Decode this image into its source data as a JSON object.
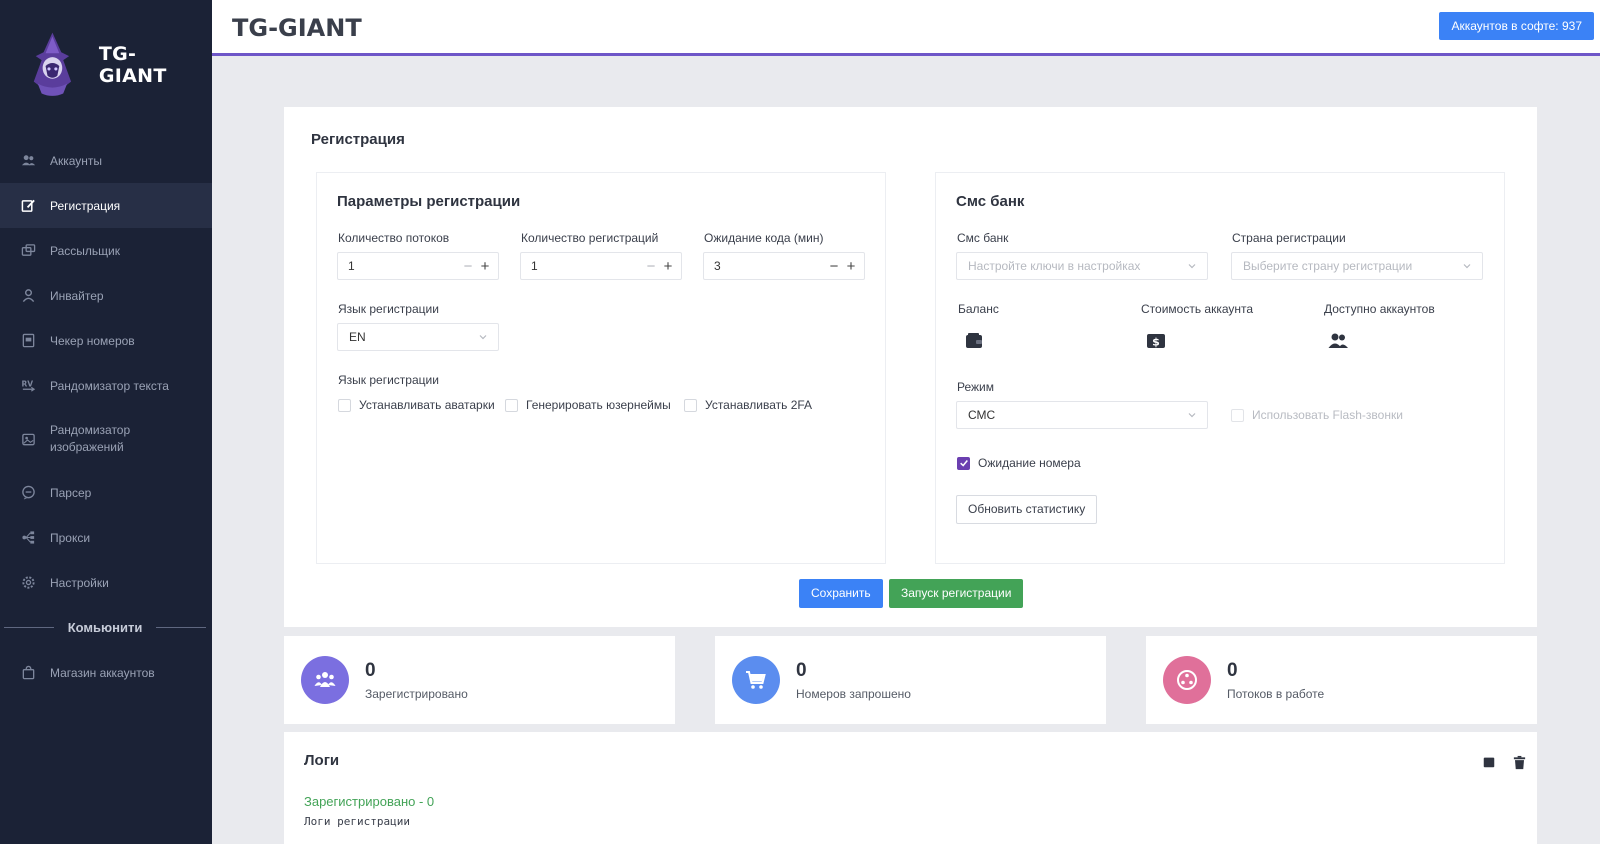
{
  "app": {
    "title": "TG-GIANT",
    "brand": "TG-GIANT"
  },
  "header": {
    "accounts_badge": "Аккаунтов в софте: 937"
  },
  "sidebar": {
    "items": [
      {
        "label": "Аккаунты",
        "icon": "users-icon"
      },
      {
        "label": "Регистрация",
        "icon": "edit-icon",
        "active": true
      },
      {
        "label": "Рассыльщик",
        "icon": "messages-icon"
      },
      {
        "label": "Инвайтер",
        "icon": "user-icon"
      },
      {
        "label": "Чекер номеров",
        "icon": "id-card-icon"
      },
      {
        "label": "Рандомизатор текста",
        "icon": "text-randomizer-icon"
      },
      {
        "label": "Рандомизатор изображений",
        "icon": "image-icon"
      },
      {
        "label": "Парсер",
        "icon": "chat-icon"
      },
      {
        "label": "Прокси",
        "icon": "network-icon"
      },
      {
        "label": "Настройки",
        "icon": "gear-icon"
      }
    ],
    "community_label": "Комьюнити",
    "shop_label": "Магазин аккаунтов"
  },
  "registration": {
    "title": "Регистрация",
    "params": {
      "title": "Параметры регистрации",
      "threads_label": "Количество потоков",
      "threads_value": "1",
      "registrations_label": "Количество регистраций",
      "registrations_value": "1",
      "wait_label": "Ожидание кода (мин)",
      "wait_value": "3",
      "language_label": "Язык регистрации",
      "language_value": "EN",
      "options_label": "Язык регистрации",
      "opt_avatars": "Устанавливать аватарки",
      "opt_usernames": "Генерировать юзернеймы",
      "opt_2fa": "Устанавливать 2FA"
    },
    "sms": {
      "title": "Смс банк",
      "bank_label": "Смс банк",
      "bank_placeholder": "Настройте ключи в настройках",
      "country_label": "Страна регистрации",
      "country_placeholder": "Выберите страну регистрации",
      "balance_label": "Баланс",
      "cost_label": "Стоимость аккаунта",
      "available_label": "Доступно аккаунтов",
      "mode_label": "Режим",
      "mode_value": "СМС",
      "flash_label": "Использовать Flash-звонки",
      "wait_number_label": "Ожидание номера",
      "refresh_button": "Обновить статистику"
    },
    "save_button": "Сохранить",
    "start_button": "Запуск регистрации"
  },
  "stats": [
    {
      "value": "0",
      "caption": "Зарегистрировано",
      "color": "#7b6fe0"
    },
    {
      "value": "0",
      "caption": "Номеров запрошено",
      "color": "#5b8def"
    },
    {
      "value": "0",
      "caption": "Потоков в работе",
      "color": "#e0709a"
    }
  ],
  "logs": {
    "title": "Логи",
    "line1": "Зарегистрировано - 0",
    "line2": "Логи регистрации"
  },
  "colors": {
    "sidebar_bg": "#1b2236",
    "accent": "#6e56c8",
    "primary": "#3b82f6",
    "success": "#43a357"
  }
}
